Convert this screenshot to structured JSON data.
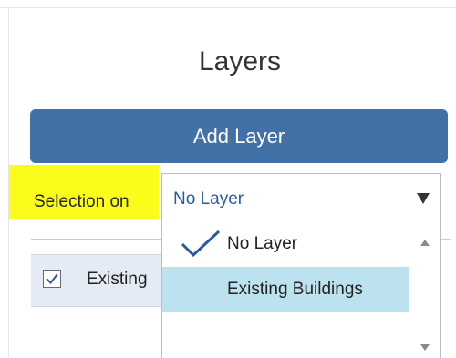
{
  "panel": {
    "title": "Layers",
    "add_layer_label": "Add Layer"
  },
  "selection": {
    "label": "Selection on",
    "current_value": "No Layer",
    "options": [
      {
        "label": "No Layer",
        "checked": true
      },
      {
        "label": "Existing Buildings",
        "checked": false,
        "hovered": true
      }
    ]
  },
  "layers": [
    {
      "label": "Existing",
      "checked": true
    }
  ],
  "colors": {
    "accent": "#4271a8",
    "highlight": "#fbfb1c",
    "option_hover": "#bde2ef",
    "select_text": "#2a5aa0"
  },
  "icons": [
    "checkmark-icon",
    "dropdown-arrow-icon",
    "scroll-up-icon",
    "scroll-down-icon",
    "checkbox-checked-icon"
  ]
}
